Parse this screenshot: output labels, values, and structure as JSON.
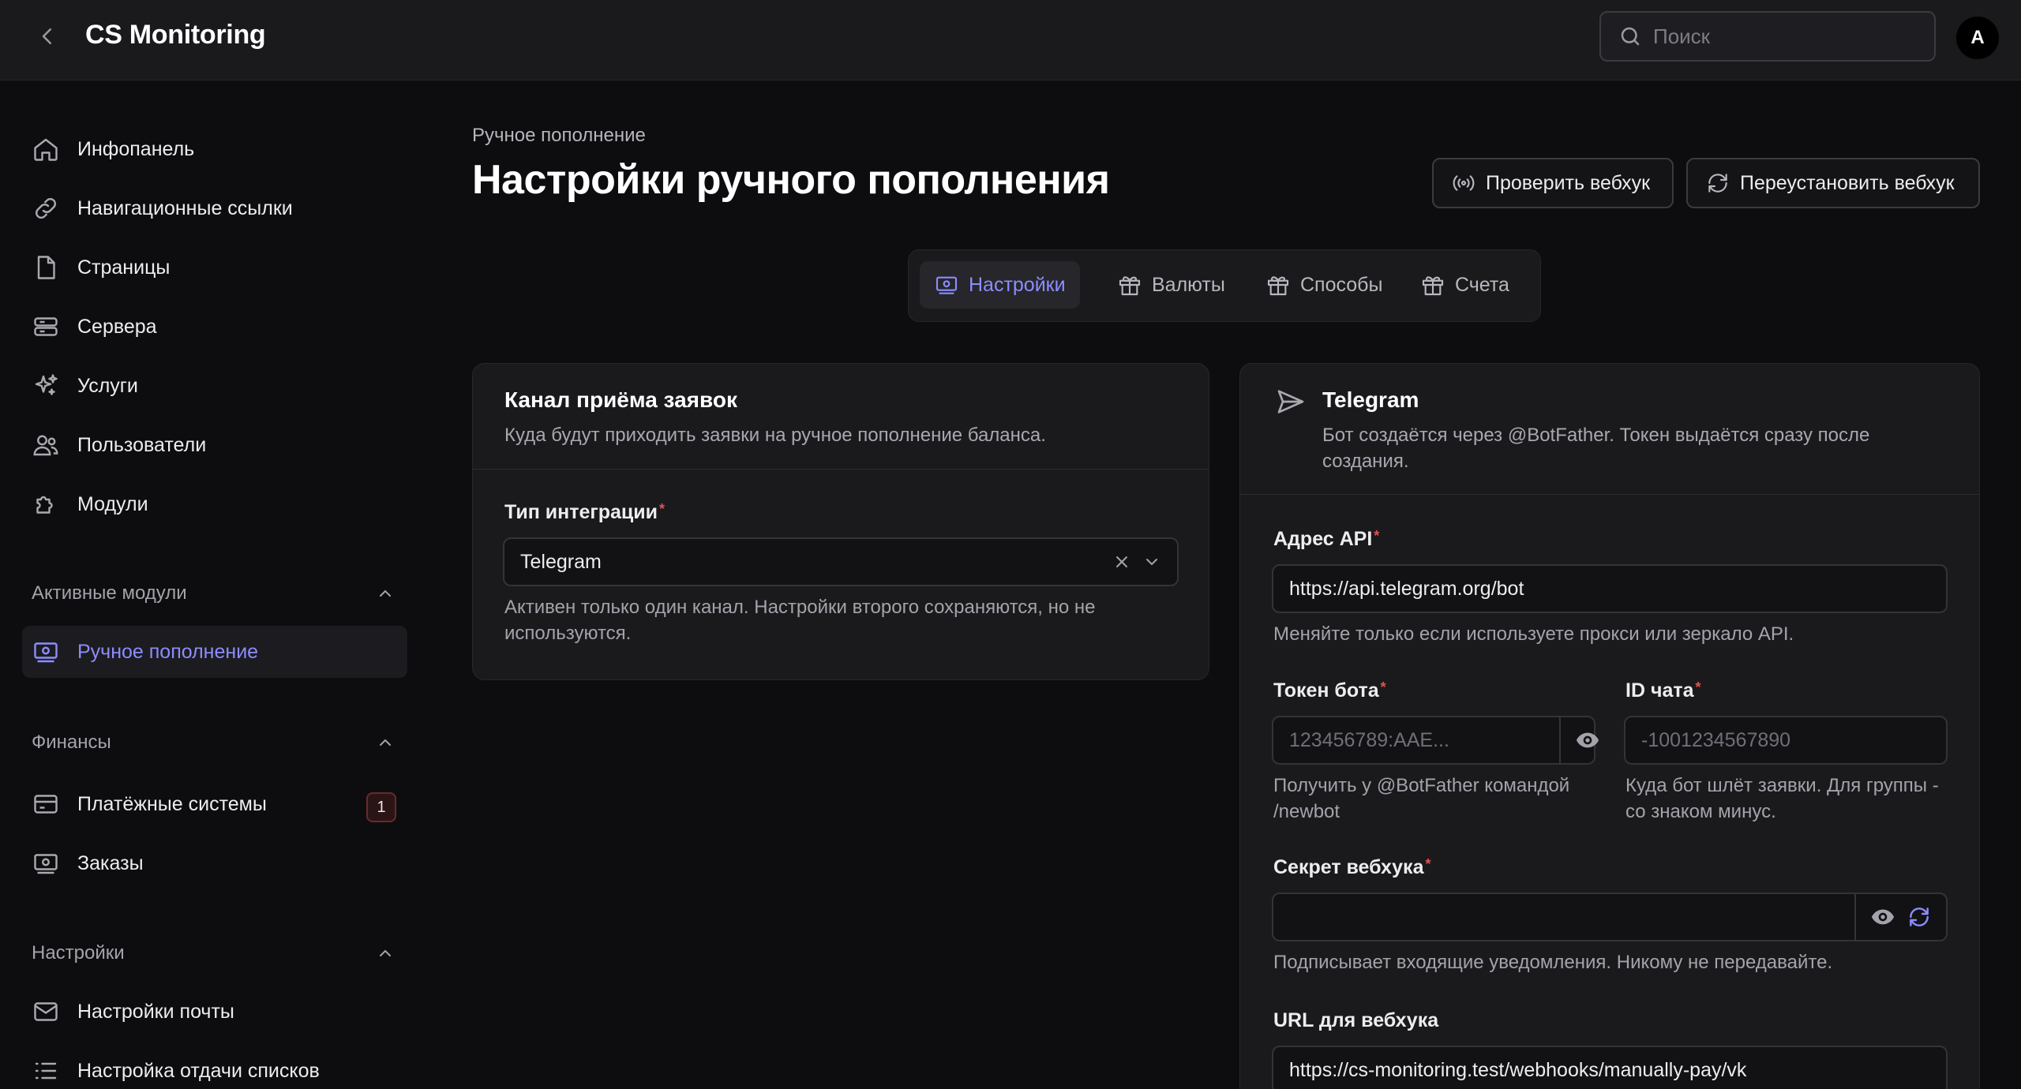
{
  "header": {
    "app_title": "CS Monitoring",
    "search_placeholder": "Поиск",
    "avatar_initial": "A"
  },
  "sidebar": {
    "items": [
      {
        "label": "Инфопанель",
        "icon": "home-icon"
      },
      {
        "label": "Навигационные ссылки",
        "icon": "link-icon"
      },
      {
        "label": "Страницы",
        "icon": "file-icon"
      },
      {
        "label": "Сервера",
        "icon": "server-icon"
      },
      {
        "label": "Услуги",
        "icon": "sparkles-icon"
      },
      {
        "label": "Пользователи",
        "icon": "users-icon"
      },
      {
        "label": "Модули",
        "icon": "puzzle-icon"
      }
    ],
    "groups": {
      "active_modules": {
        "title": "Активные модули",
        "items": [
          {
            "label": "Ручное пополнение",
            "icon": "money-icon"
          }
        ]
      },
      "finance": {
        "title": "Финансы",
        "items": [
          {
            "label": "Платёжные системы",
            "icon": "credit-card-icon",
            "badge": "1"
          },
          {
            "label": "Заказы",
            "icon": "money-icon"
          }
        ]
      },
      "settings": {
        "title": "Настройки",
        "items": [
          {
            "label": "Настройки почты",
            "icon": "mail-icon"
          },
          {
            "label": "Настройка отдачи списков",
            "icon": "list-icon"
          }
        ]
      }
    }
  },
  "main": {
    "breadcrumb": "Ручное пополнение",
    "title": "Настройки ручного пополнения",
    "actions": {
      "check_webhook": "Проверить вебхук",
      "reinstall_webhook": "Переустановить вебхук"
    },
    "tabs": [
      {
        "label": "Настройки",
        "icon": "money-icon"
      },
      {
        "label": "Валюты",
        "icon": "gift-icon"
      },
      {
        "label": "Способы",
        "icon": "gift-icon"
      },
      {
        "label": "Счета",
        "icon": "gift-icon"
      }
    ],
    "channel_card": {
      "title": "Канал приёма заявок",
      "subtitle": "Куда будут приходить заявки на ручное пополнение баланса.",
      "integration_label": "Тип интеграции",
      "integration_value": "Telegram",
      "integration_help": "Активен только один канал. Настройки второго сохраняются, но не используются."
    },
    "telegram_card": {
      "title": "Telegram",
      "subtitle": "Бот создаётся через @BotFather. Токен выдаётся сразу после создания.",
      "api_label": "Адрес API",
      "api_value": "https://api.telegram.org/bot",
      "api_help": "Меняйте только если используете прокси или зеркало API.",
      "token_label": "Токен бота",
      "token_placeholder": "123456789:AAE...",
      "token_help": "Получить у @BotFather командой /newbot",
      "chat_label": "ID чата",
      "chat_placeholder": "-1001234567890",
      "chat_help": "Куда бот шлёт заявки. Для группы - со знаком минус.",
      "secret_label": "Секрет вебхука",
      "secret_value": "",
      "secret_help": "Подписывает входящие уведомления. Никому не передавайте.",
      "url_label": "URL для вебхука",
      "url_value": "https://cs-monitoring.test/webhooks/manually-pay/vk"
    }
  },
  "colors": {
    "accent": "#8d8cff",
    "background": "#0d0d0f",
    "surface": "#1a1a1d",
    "required": "#e05252"
  }
}
